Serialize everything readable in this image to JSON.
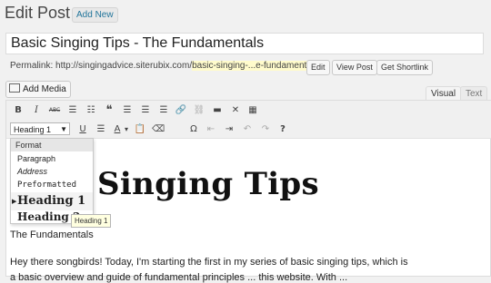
{
  "header": {
    "title": "Edit Post",
    "add_new": "Add New"
  },
  "post": {
    "title": "Basic Singing Tips - The Fundamentals"
  },
  "permalink": {
    "label": "Permalink:",
    "base": "http://singingadvice.siterubix.com/",
    "slug": "basic-singing-...e-fundamentals",
    "suffix": "/",
    "edit": "Edit",
    "view": "View Post",
    "shortlink": "Get Shortlink"
  },
  "media": {
    "add_media": "Add Media"
  },
  "tabs": {
    "visual": "Visual",
    "text": "Text"
  },
  "toolbar": {
    "row1": [
      "B",
      "I",
      "ABC",
      "☰",
      "☷",
      "❝",
      "☰",
      "☰",
      "☰",
      "🔗",
      "⛓",
      "▬",
      "✕",
      "▦"
    ],
    "row2": [
      "U",
      "☰",
      "A",
      "▾",
      "📋",
      "⌫",
      "Ω",
      "⇤",
      "⇥",
      "↶",
      "↷",
      "?"
    ],
    "format_selected": "Heading 1"
  },
  "format_menu": {
    "header": "Format",
    "items": [
      "Paragraph",
      "Address",
      "Preformatted",
      "Heading 1",
      "Heading 2"
    ],
    "tooltip": "Heading 1"
  },
  "content": {
    "heading": "Singing Tips",
    "subtitle": "The Fundamentals",
    "paragraph": "Hey there songbirds!  Today, I'm starting the first in my series of basic singing tips, which is",
    "paragraph_cut": "a basic overview and guide of fundamental principles ... this website. With ..."
  }
}
